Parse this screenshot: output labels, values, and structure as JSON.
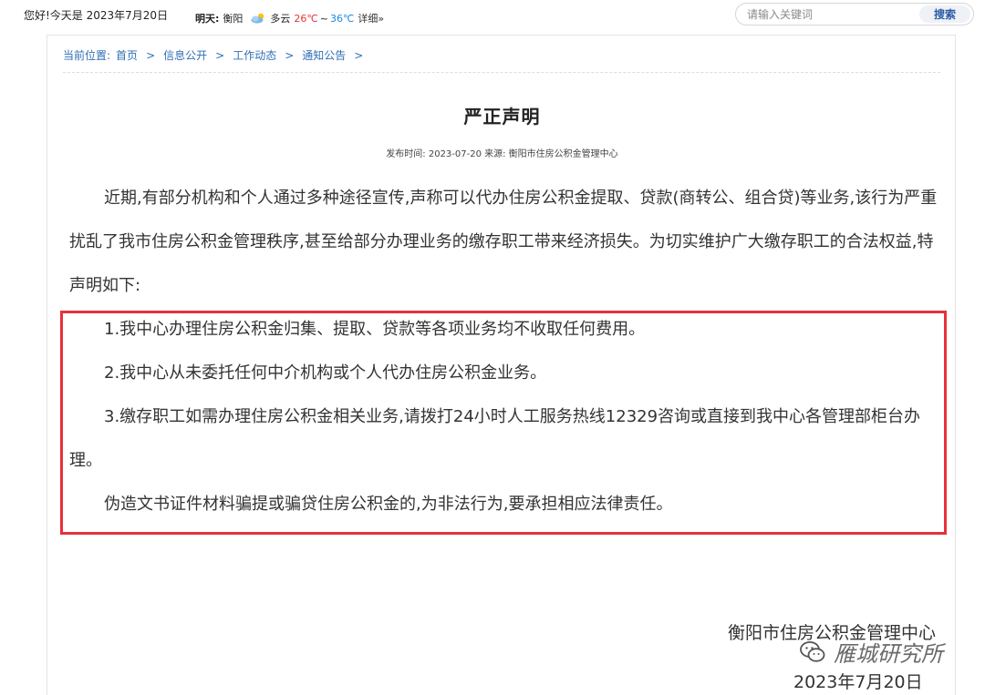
{
  "topbar": {
    "greeting": "您好!今天是 2023年7月20日",
    "weather": {
      "label": "明天:",
      "city": "衡阳",
      "condition": "多云",
      "high": "26℃",
      "tilde": "~",
      "low": "36℃",
      "detail": "详细»",
      "icon": "cloud-sun-icon"
    },
    "search": {
      "placeholder": "请输入关键词",
      "button": "搜索"
    }
  },
  "breadcrumb": {
    "prefix": "当前位置:",
    "items": [
      "首页",
      "信息公开",
      "工作动态",
      "通知公告"
    ],
    "separator": ">"
  },
  "article": {
    "title": "严正声明",
    "meta": "发布时间: 2023-07-20 来源: 衡阳市住房公积金管理中心",
    "intro": "近期,有部分机构和个人通过多种途径宣传,声称可以代办住房公积金提取、贷款(商转公、组合贷)等业务,该行为严重扰乱了我市住房公积金管理秩序,甚至给部分办理业务的缴存职工带来经济损失。为切实维护广大缴存职工的合法权益,特声明如下:",
    "points": [
      "1.我中心办理住房公积金归集、提取、贷款等各项业务均不收取任何费用。",
      "2.我中心从未委托任何中介机构或个人代办住房公积金业务。",
      "3.缴存职工如需办理住房公积金相关业务,请拨打24小时人工服务热线12329咨询或直接到我中心各管理部柜台办理。",
      "伪造文书证件材料骗提或骗贷住房公积金的,为非法行为,要承担相应法律责任。"
    ],
    "signature": "衡阳市住房公积金管理中心",
    "date": "2023年7月20日"
  },
  "watermark": {
    "text": "雁城研究所",
    "icon": "wechat-icon"
  },
  "colors": {
    "link": "#2f6fb5",
    "highlight": "#e8303a",
    "temp_high": "#e53935",
    "temp_low": "#1e88e5"
  }
}
